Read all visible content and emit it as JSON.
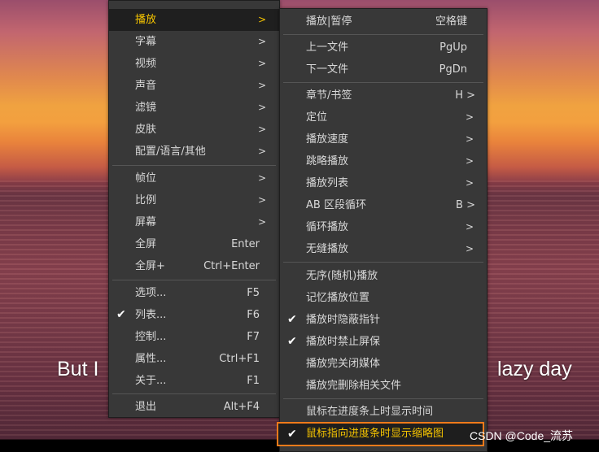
{
  "video": {
    "subtitle_left": "But I",
    "subtitle_right": "lazy day",
    "watermark": "CSDN @Code_流苏"
  },
  "main_menu": {
    "items": [
      {
        "label": "播放",
        "arrow": ">"
      },
      {
        "label": "字幕",
        "arrow": ">"
      },
      {
        "label": "视频",
        "arrow": ">"
      },
      {
        "label": "声音",
        "arrow": ">"
      },
      {
        "label": "滤镜",
        "arrow": ">"
      },
      {
        "label": "皮肤",
        "arrow": ">"
      },
      {
        "label": "配置/语言/其他",
        "arrow": ">"
      },
      {
        "label": "帧位",
        "arrow": ">"
      },
      {
        "label": "比例",
        "arrow": ">"
      },
      {
        "label": "屏幕",
        "arrow": ">"
      },
      {
        "label": "全屏",
        "shortcut": "Enter"
      },
      {
        "label": "全屏+",
        "shortcut": "Ctrl+Enter"
      },
      {
        "label": "选项...",
        "shortcut": "F5"
      },
      {
        "label": "列表...",
        "shortcut": "F6",
        "checked": "✔"
      },
      {
        "label": "控制...",
        "shortcut": "F7"
      },
      {
        "label": "属性...",
        "shortcut": "Ctrl+F1"
      },
      {
        "label": "关于...",
        "shortcut": "F1"
      },
      {
        "label": "退出",
        "shortcut": "Alt+F4"
      }
    ]
  },
  "play_submenu": {
    "items": [
      {
        "label": "播放|暂停",
        "shortcut": "空格键"
      },
      {
        "label": "上一文件",
        "shortcut": "PgUp"
      },
      {
        "label": "下一文件",
        "shortcut": "PgDn"
      },
      {
        "label": "章节/书签",
        "shortcut": "H >"
      },
      {
        "label": "定位",
        "arrow": ">"
      },
      {
        "label": "播放速度",
        "arrow": ">"
      },
      {
        "label": "跳略播放",
        "arrow": ">"
      },
      {
        "label": "播放列表",
        "arrow": ">"
      },
      {
        "label": "AB 区段循环",
        "shortcut": "B >"
      },
      {
        "label": "循环播放",
        "arrow": ">"
      },
      {
        "label": "无缝播放",
        "arrow": ">"
      },
      {
        "label": "无序(随机)播放"
      },
      {
        "label": "记忆播放位置"
      },
      {
        "label": "播放时隐蔽指针",
        "checked": "✔"
      },
      {
        "label": "播放时禁止屏保",
        "checked": "✔"
      },
      {
        "label": "播放完关闭媒体"
      },
      {
        "label": "播放完删除相关文件"
      },
      {
        "label": "鼠标在进度条上时显示时间"
      },
      {
        "label": "鼠标指向进度条时显示缩略图",
        "checked": "✔"
      }
    ]
  },
  "colors": {
    "menu_bg": "#383838",
    "menu_text": "#d8d8d8",
    "selected_text": "#f5c400",
    "highlight_border": "#f07a1a"
  }
}
